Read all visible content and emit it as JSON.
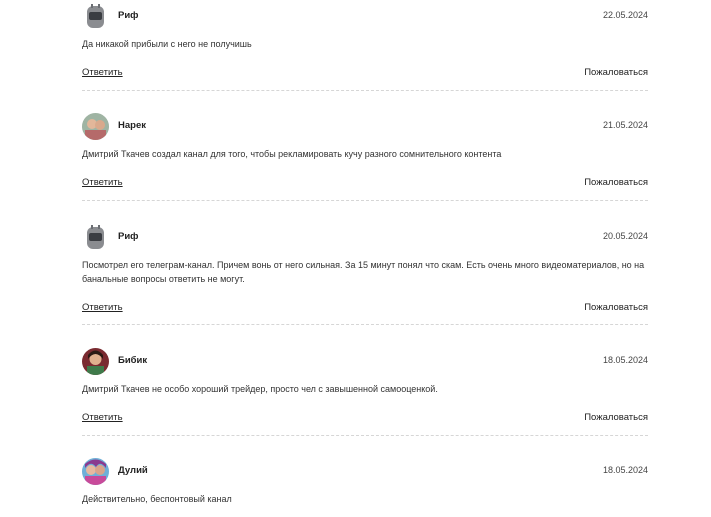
{
  "actions": {
    "reply_label": "Ответить",
    "report_label": "Пожаловаться"
  },
  "comments": [
    {
      "author": "Риф",
      "date": "22.05.2024",
      "avatar": "robot-avatar",
      "lines": [
        "Да никакой прибыли с него не получишь"
      ]
    },
    {
      "author": "Нарек",
      "date": "21.05.2024",
      "avatar": "photo-avatar",
      "lines": [
        "Дмитрий Ткачев создал канал для того, чтобы рекламировать кучу разного сомнительного контента"
      ]
    },
    {
      "author": "Риф",
      "date": "20.05.2024",
      "avatar": "robot-avatar",
      "lines": [
        "Посмотрел его телеграм-канал. Причем вонь от него сильная. За 15 минут понял что скам. Есть очень много видеоматериалов, но на",
        "банальные вопросы ответить не могут."
      ]
    },
    {
      "author": "Бибик",
      "date": "18.05.2024",
      "avatar": "photo-avatar",
      "lines": [
        "Дмитрий Ткачев не особо хороший трейдер, просто чел с завышенной самооценкой."
      ]
    },
    {
      "author": "Дулий",
      "date": "18.05.2024",
      "avatar": "photo-avatar",
      "lines": [
        "Действительно, беспонтовый канал"
      ]
    }
  ]
}
